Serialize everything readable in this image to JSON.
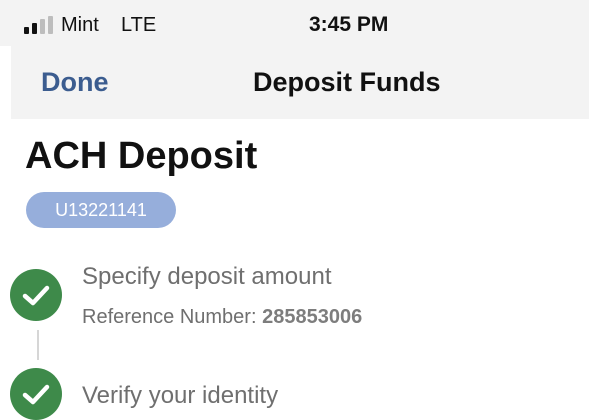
{
  "status_bar": {
    "carrier": "Mint",
    "network": "LTE",
    "time": "3:45 PM"
  },
  "nav": {
    "done_label": "Done",
    "title": "Deposit Funds"
  },
  "page": {
    "title": "ACH Deposit",
    "account_id": "U13221141"
  },
  "steps": [
    {
      "label": "Specify deposit amount",
      "reference_label": "Reference Number:",
      "reference_number": "285853006",
      "status": "complete",
      "icon": "check-icon"
    },
    {
      "label": "Verify your identity",
      "status": "complete",
      "icon": "check-icon"
    }
  ],
  "colors": {
    "accent": "#3b5c8f",
    "badge": "#96aedb",
    "success": "#3e8a4a"
  }
}
